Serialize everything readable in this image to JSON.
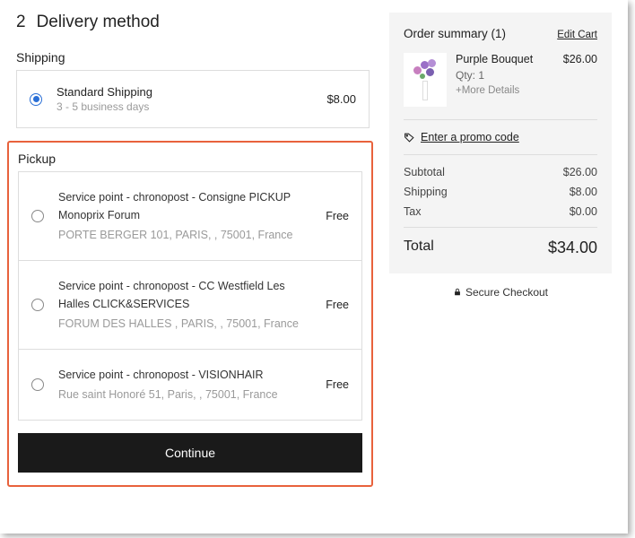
{
  "step": {
    "number": "2",
    "title": "Delivery method"
  },
  "shipping": {
    "section_label": "Shipping",
    "option": {
      "name": "Standard Shipping",
      "sub": "3 - 5 business days",
      "price": "$8.00"
    }
  },
  "pickup": {
    "section_label": "Pickup",
    "options": [
      {
        "title": "Service point - chronopost - Consigne PICKUP Monoprix Forum",
        "addr": "PORTE BERGER 101, PARIS, , 75001, France",
        "price": "Free"
      },
      {
        "title": "Service point - chronopost - CC Westfield Les Halles CLICK&SERVICES",
        "addr": "FORUM DES HALLES , PARIS, , 75001, France",
        "price": "Free"
      },
      {
        "title": "Service point - chronopost - VISIONHAIR",
        "addr": "Rue saint Honoré 51, Paris, , 75001, France",
        "price": "Free"
      }
    ],
    "continue_label": "Continue"
  },
  "summary": {
    "title": "Order summary (1)",
    "edit_label": "Edit Cart",
    "product": {
      "name": "Purple Bouquet",
      "qty": "Qty: 1",
      "more": "+More Details",
      "price": "$26.00"
    },
    "promo_label": "Enter a promo code",
    "lines": {
      "subtotal_label": "Subtotal",
      "subtotal_value": "$26.00",
      "shipping_label": "Shipping",
      "shipping_value": "$8.00",
      "tax_label": "Tax",
      "tax_value": "$0.00"
    },
    "total_label": "Total",
    "total_value": "$34.00",
    "secure_label": "Secure Checkout"
  }
}
